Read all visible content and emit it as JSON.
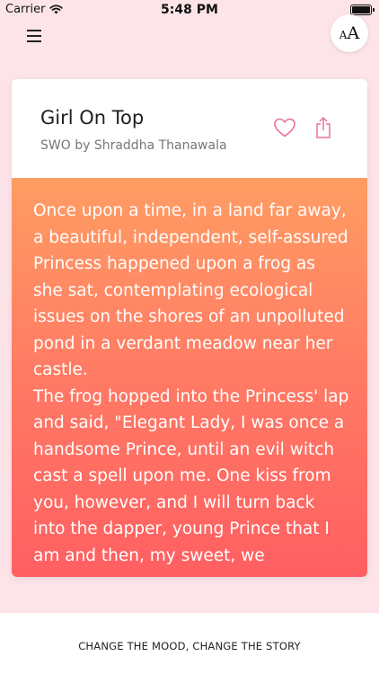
{
  "status_bar": {
    "carrier": "Carrier",
    "time": "5:48 PM"
  },
  "toolbar": {
    "font_size_small": "A",
    "font_size_large": "A"
  },
  "story": {
    "title": "Girl On Top",
    "author": "SWO by Shraddha Thanawala",
    "text": "Once upon a time, in a land far away, a beautiful, independent, self-assured Princess happened upon a frog as she sat, contemplating ecological issues on the shores of an unpolluted pond in a verdant meadow near her castle.\nThe frog hopped into the Princess' lap and said, \"Elegant Lady, I was once a handsome Prince, until an evil witch cast a spell upon me. One kiss from you, however, and I will turn back into the dapper, young Prince that I am and then, my sweet, we"
  },
  "footer": {
    "tagline": "CHANGE THE MOOD, CHANGE THE STORY"
  },
  "colors": {
    "background": "#fde4e9",
    "accent": "#e8739a",
    "gradient_top": "#ff9d63",
    "gradient_bottom": "#ff5f62"
  }
}
